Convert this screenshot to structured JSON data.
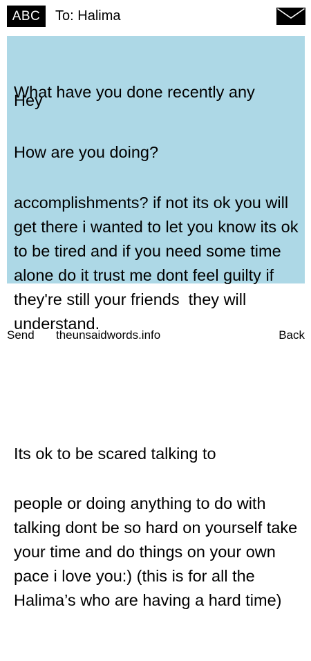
{
  "header": {
    "input_mode": "ABC",
    "to_label": "To:",
    "recipient": "Halima",
    "icon": "envelope-icon"
  },
  "message": {
    "greeting": "Hey",
    "line2": "How are you doing?",
    "line3": "What have you done recently  any",
    "paragraph1": "accomplishments? if not its ok you will get there i wanted to let you know its ok to be tired and if you need some time alone do it trust me dont feel guilty if they're still your friends  they will understand.",
    "paragraph2_start": "Its ok to be scared talking to",
    "paragraph2": "people or doing anything to do with talking dont be so hard on yourself take your time and do things on your own pace i love you:) (this is for all the Halima’s who are having a hard time)"
  },
  "footer": {
    "left_key": "Send",
    "site": "theunsaidwords.info",
    "right_key": "Back"
  },
  "colors": {
    "message_background": "#add8e6",
    "badge_background": "#000000"
  }
}
